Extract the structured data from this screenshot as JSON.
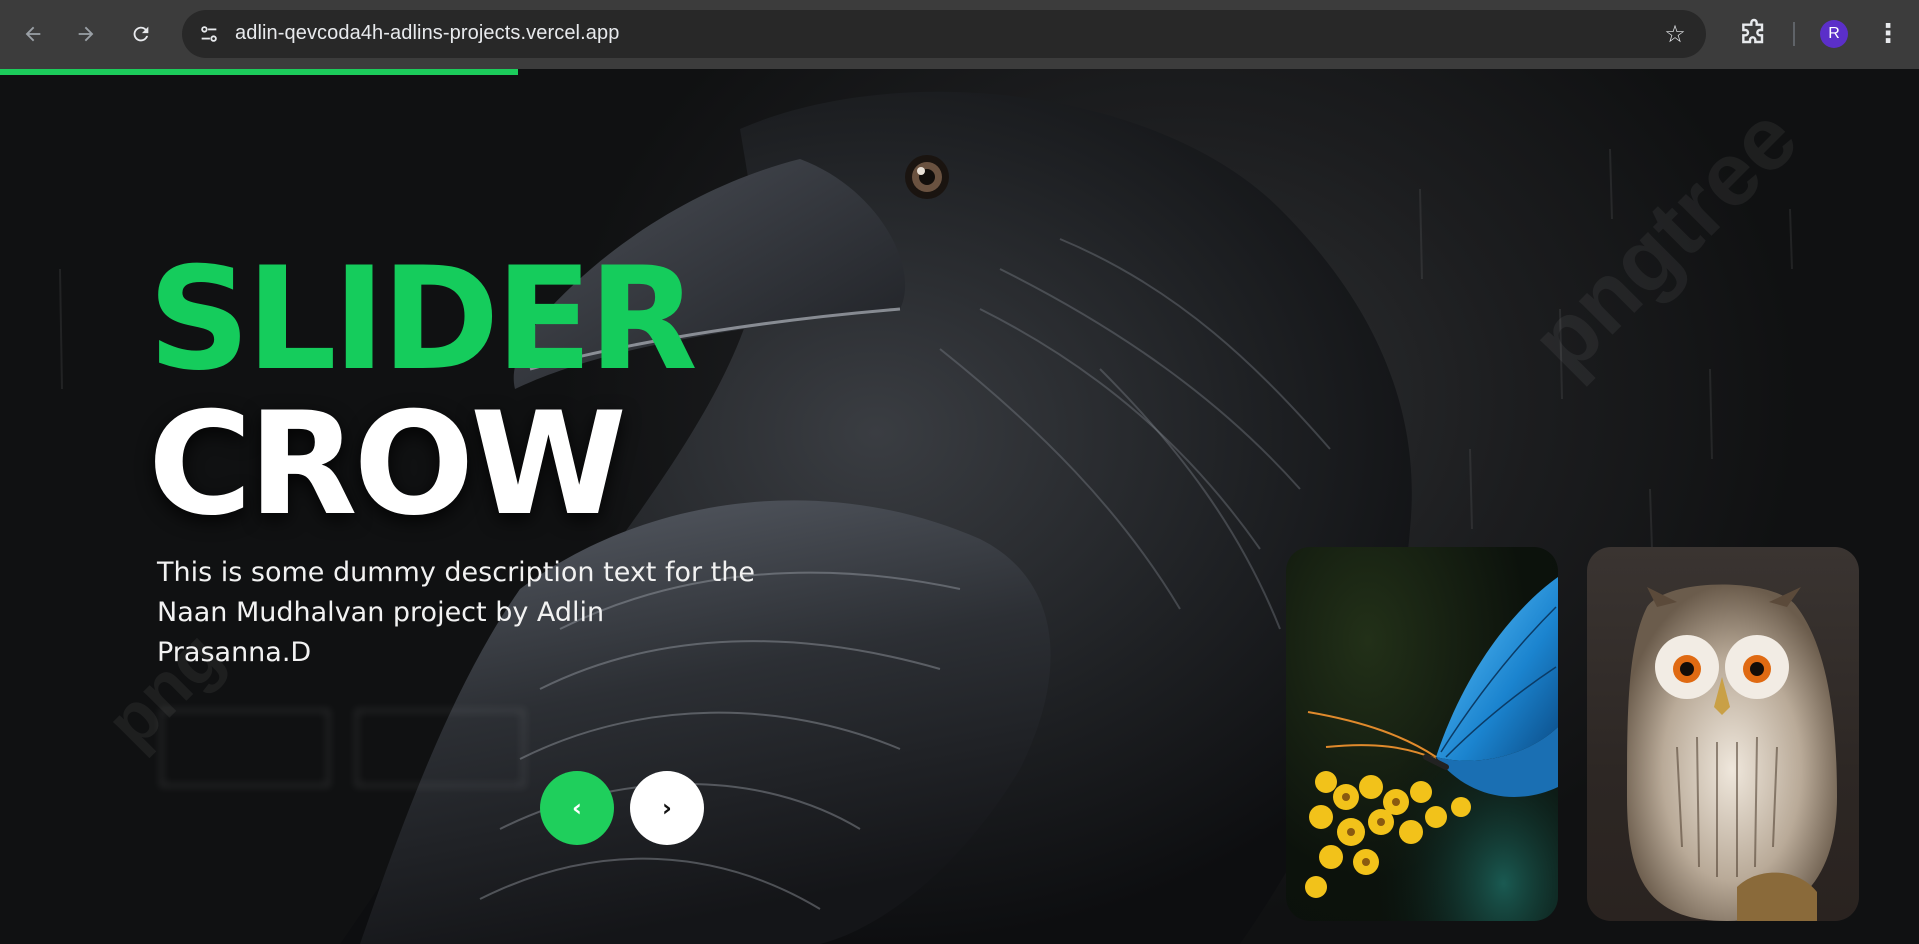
{
  "browser": {
    "url": "adlin-qevcoda4h-adlins-projects.vercel.app",
    "profile_initial": "R",
    "icons": [
      "back-icon",
      "forward-icon",
      "reload-icon",
      "site-info-icon",
      "bookmark-star-icon",
      "extensions-icon",
      "menu-icon"
    ]
  },
  "slider": {
    "title_top": "SLIDER",
    "title_bottom": "CROW",
    "description": "This is some dummy description text for the Naan Mudhalvan project by Adlin Prasanna.D",
    "prev_label": "‹",
    "next_label": "›",
    "progress_fraction": 0.27
  },
  "colors": {
    "accent": "#15cc5c",
    "title_white": "#ffffff",
    "progress": "#1ccc5b"
  }
}
